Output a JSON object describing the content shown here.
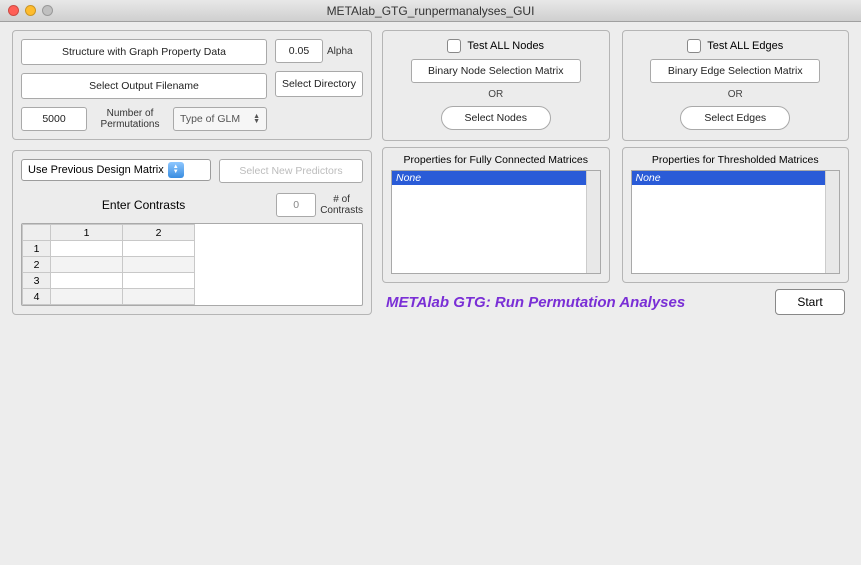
{
  "window": {
    "title": "METAlab_GTG_runpermanalyses_GUI"
  },
  "left_top": {
    "structure_btn": "Structure with Graph Property Data",
    "output_btn": "Select Output Filename",
    "alpha_value": "0.05",
    "alpha_label": "Alpha",
    "select_dir_btn": "Select Directory",
    "perm_value": "5000",
    "perm_label": "Number of\nPermutations",
    "glm_placeholder": "Type of GLM"
  },
  "design": {
    "prev_matrix_label": "Use Previous Design Matrix",
    "select_predictors_btn": "Select New Predictors"
  },
  "contrasts": {
    "title": "Enter Contrasts",
    "num_value": "0",
    "num_label": "# of\nContrasts",
    "col_headers": [
      "1",
      "2"
    ],
    "row_headers": [
      "1",
      "2",
      "3",
      "4"
    ]
  },
  "nodes_panel": {
    "test_all": "Test ALL Nodes",
    "matrix_btn": "Binary Node Selection Matrix",
    "or": "OR",
    "select_btn": "Select Nodes"
  },
  "edges_panel": {
    "test_all": "Test ALL Edges",
    "matrix_btn": "Binary Edge Selection Matrix",
    "or": "OR",
    "select_btn": "Select Edges"
  },
  "props_full": {
    "title": "Properties for Fully Connected Matrices",
    "selected": "None"
  },
  "props_thresh": {
    "title": "Properties for Thresholded Matrices",
    "selected": "None"
  },
  "footer": {
    "title": "METAlab GTG: Run Permutation Analyses",
    "start_btn": "Start"
  }
}
